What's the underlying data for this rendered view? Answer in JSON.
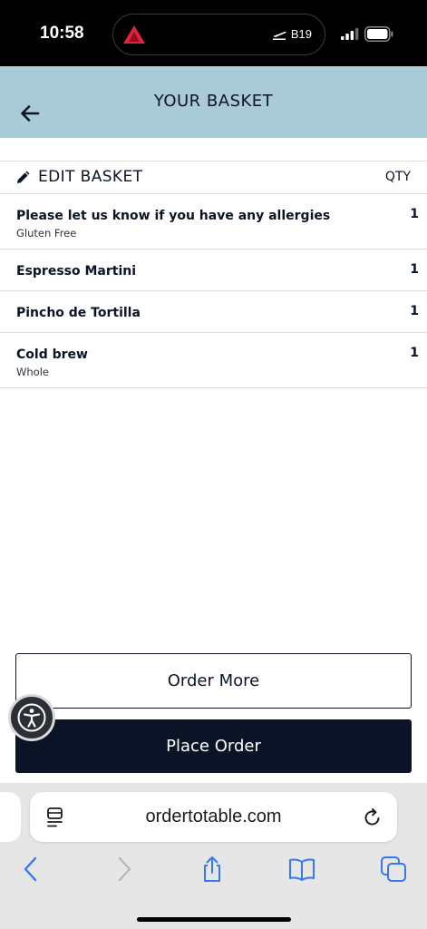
{
  "status_bar": {
    "time": "10:58",
    "flight_gate": "B19"
  },
  "header": {
    "title": "YOUR BASKET",
    "back_icon": "arrow-left-icon"
  },
  "edit_section": {
    "edit_label": "EDIT BASKET",
    "qty_label": "QTY"
  },
  "items": [
    {
      "name": "Please let us know if you have any allergies",
      "detail": "Gluten Free",
      "qty": "1"
    },
    {
      "name": "Espresso Martini",
      "detail": "",
      "qty": "1"
    },
    {
      "name": "Pincho de Tortilla",
      "detail": "",
      "qty": "1"
    },
    {
      "name": "Cold brew",
      "detail": "Whole",
      "qty": "1"
    }
  ],
  "buttons": {
    "order_more": "Order More",
    "place_order": "Place Order"
  },
  "browser": {
    "url": "ordertotable.com"
  },
  "colors": {
    "header_bg": "#a9cad7",
    "primary_dark": "#0b1426",
    "safari_blue": "#3478f6"
  }
}
